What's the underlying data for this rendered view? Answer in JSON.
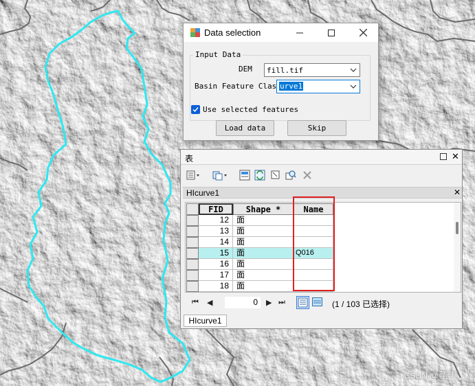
{
  "dialog": {
    "title": "Data selection",
    "group_title": "Input Data",
    "dem_label": "DEM",
    "dem_value": "fill.tif",
    "basin_label": "Basin Feature Class",
    "basin_value": "urve1",
    "checkbox_label": "Use selected features",
    "checkbox_checked": true,
    "load_button": "Load data",
    "skip_button": "Skip"
  },
  "table_window": {
    "title": "表",
    "layer_tab": "HIcurve1",
    "columns": [
      "FID",
      "Shape *",
      "Name"
    ],
    "rows": [
      {
        "fid": "12",
        "shape": "面",
        "name": ""
      },
      {
        "fid": "13",
        "shape": "面",
        "name": ""
      },
      {
        "fid": "14",
        "shape": "面",
        "name": ""
      },
      {
        "fid": "15",
        "shape": "面",
        "name": "Q016"
      },
      {
        "fid": "16",
        "shape": "面",
        "name": ""
      },
      {
        "fid": "17",
        "shape": "面",
        "name": ""
      },
      {
        "fid": "18",
        "shape": "面",
        "name": ""
      }
    ],
    "highlighted_row_fid": "15",
    "page_value": "0",
    "selection_status": "(1 / 103 已选择)",
    "bottom_tab": "HIcurve1"
  },
  "watermark": "CSDN @寻寻I",
  "colors": {
    "basin_outline": "#2ee8f0",
    "highlight_row": "#b8f0f0",
    "annotation_box": "#e02020",
    "checkbox_accent": "#0b5ed7"
  }
}
